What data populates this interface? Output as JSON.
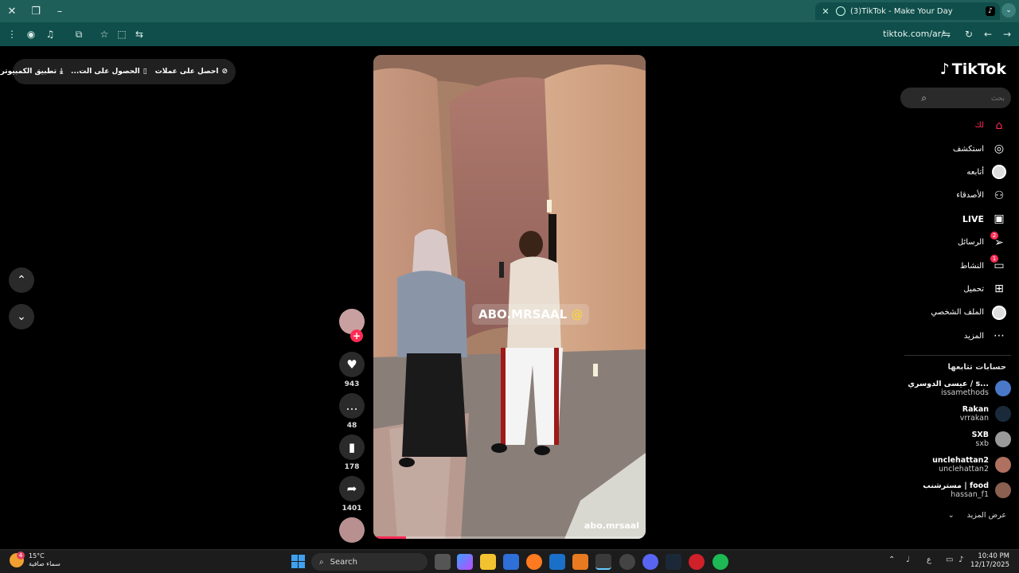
{
  "browser": {
    "tab_title": "(3)TikTok - Make Your Day",
    "url": "tiktok.com/ar/"
  },
  "topbar": {
    "get_coins": "احصل على عملات",
    "get_app": "الحصول على الت...",
    "desktop_app": "تطبيق الكمبيوتر"
  },
  "video": {
    "overlay_handle": "ABO.MRSAAL",
    "overlay_at": "@",
    "watermark": "abo.mrsaal",
    "progress": 0.12
  },
  "actions": {
    "likes": "943",
    "comments": "48",
    "saves": "178",
    "shares": "1401",
    "follow_plus": "+"
  },
  "sidebar": {
    "logo": "TikTok",
    "search_placeholder": "بحث",
    "nav": [
      {
        "label": "لك",
        "icon": "home-icon",
        "active": true
      },
      {
        "label": "استكشف",
        "icon": "compass-icon"
      },
      {
        "label": "أتابعه",
        "icon": "following-avatar-icon"
      },
      {
        "label": "الأصدقاء",
        "icon": "friends-icon"
      },
      {
        "label": "LIVE",
        "icon": "live-icon"
      },
      {
        "label": "الرسائل",
        "icon": "messages-icon",
        "badge": "2"
      },
      {
        "label": "النشاط",
        "icon": "activity-icon",
        "badge": "1"
      },
      {
        "label": "تحميل",
        "icon": "upload-icon"
      },
      {
        "label": "الملف الشخصي",
        "icon": "profile-avatar-icon"
      },
      {
        "label": "المزيد",
        "icon": "more-icon"
      }
    ],
    "following_title": "حسابات تتابعها",
    "accounts": [
      {
        "name": "عيسى الدوسري / s...",
        "username": "issamethods",
        "color": "#4a78c8"
      },
      {
        "name": "Rakan",
        "username": "vrrakan",
        "color": "#1a2a3a"
      },
      {
        "name": "SXB",
        "username": "sxb",
        "color": "#9a9a9a"
      },
      {
        "name": "unclehattan2",
        "username": "unclehattan2",
        "color": "#b07060"
      },
      {
        "name": "مسترشنب | food",
        "username": "hassan_f1",
        "color": "#8a6050",
        "verified": true
      }
    ],
    "show_more": "عرض المزيد"
  },
  "taskbar": {
    "temp": "15°C",
    "weather_desc": "سماء صافية",
    "weather_badge": "4",
    "search": "Search",
    "time": "10:40 PM",
    "date": "12/17/2025",
    "lang": "ع"
  }
}
